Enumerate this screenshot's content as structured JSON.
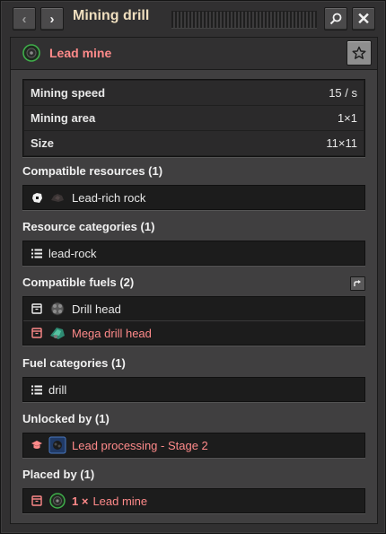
{
  "window": {
    "title": "Mining drill",
    "back_glyph": "‹",
    "forward_glyph": "›",
    "close_glyph": "✕"
  },
  "header": {
    "entity_name": "Lead mine",
    "entity_color": "#ff8a8a"
  },
  "stats": [
    {
      "label": "Mining speed",
      "value": "15 / s"
    },
    {
      "label": "Mining area",
      "value": "1×1"
    },
    {
      "label": "Size",
      "value": "11×11"
    }
  ],
  "sections": {
    "compatible_resources": {
      "label": "Compatible resources (1)",
      "items": [
        {
          "label": "Lead-rich rock",
          "kind_icon": "resource-icon",
          "item_icon": "lead-rock-icon"
        }
      ]
    },
    "resource_categories": {
      "label": "Resource categories (1)",
      "items": [
        {
          "label": "lead-rock",
          "kind_icon": "list-icon"
        }
      ]
    },
    "compatible_fuels": {
      "label": "Compatible fuels (2)",
      "items": [
        {
          "label": "Drill head",
          "kind_icon": "item-icon",
          "item_icon": "drill-head-icon",
          "color": "#e8e8e8"
        },
        {
          "label": "Mega drill head",
          "kind_icon": "item-icon",
          "item_icon": "mega-drill-head-icon",
          "color": "#ff8a8a"
        }
      ]
    },
    "fuel_categories": {
      "label": "Fuel categories (1)",
      "items": [
        {
          "label": "drill",
          "kind_icon": "list-icon"
        }
      ]
    },
    "unlocked_by": {
      "label": "Unlocked by (1)",
      "items": [
        {
          "label": "Lead processing - Stage 2",
          "kind_icon": "technology-icon",
          "item_icon": "lead-processing-icon",
          "color": "#ff8a8a"
        }
      ]
    },
    "placed_by": {
      "label": "Placed by (1)",
      "items": [
        {
          "count": "1 ×",
          "label": "Lead mine",
          "kind_icon": "item-icon",
          "item_icon": "lead-mine-icon",
          "color": "#ff8a8a"
        }
      ]
    }
  }
}
